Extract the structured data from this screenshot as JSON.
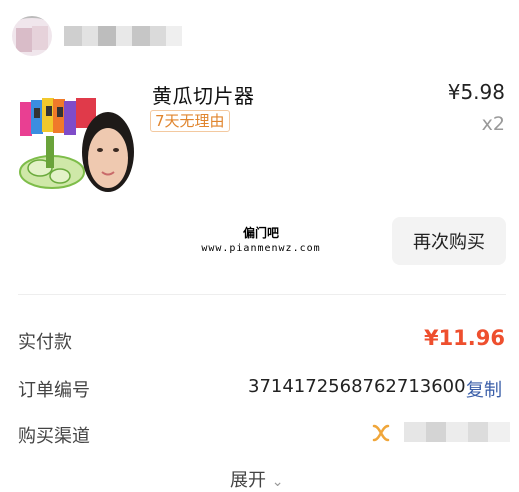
{
  "product": {
    "title": "黄瓜切片器",
    "tag": "7天无理由",
    "price": "¥5.98",
    "quantity": "x2"
  },
  "watermark": {
    "name": "偏门吧",
    "url": "www.pianmenwz.com"
  },
  "actions": {
    "rebuy_label": "再次购买"
  },
  "details": {
    "paid_label": "实付款",
    "paid_value": "¥11.96",
    "order_label": "订单编号",
    "order_value": "3714172568762713600",
    "copy_label": "复制",
    "channel_label": "购买渠道",
    "expand_label": "展开"
  },
  "colors": {
    "accent_price": "#ee4f2e",
    "tag_orange": "#e0852e",
    "link_blue": "#3a5ea8",
    "channel_icon": "#f0a63a"
  }
}
